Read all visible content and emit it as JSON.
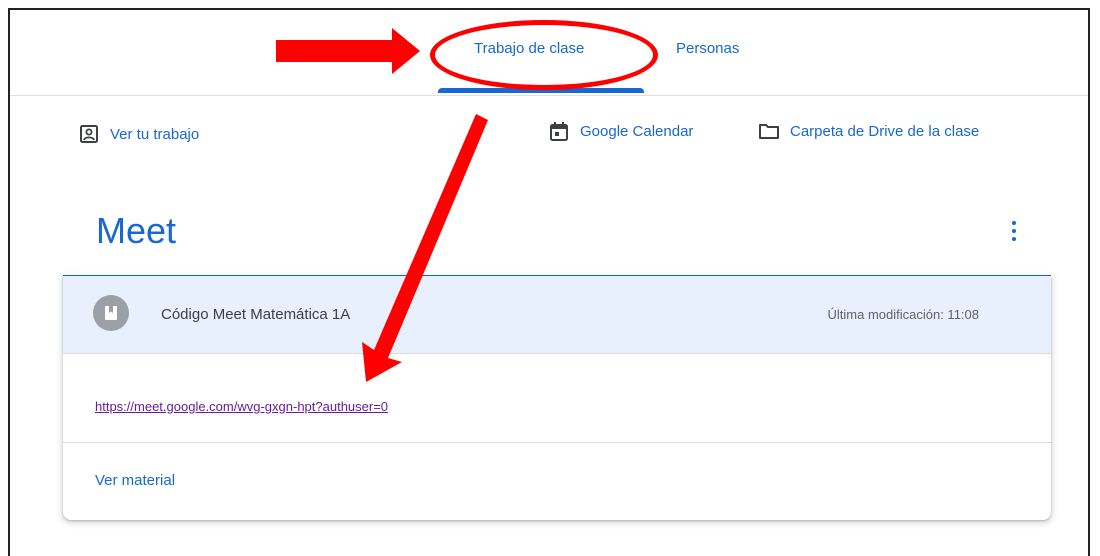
{
  "tabs": {
    "classwork": "Trabajo de clase",
    "people": "Personas"
  },
  "toolbar": {
    "my_work": "Ver tu trabajo",
    "calendar": "Google Calendar",
    "drive_folder": "Carpeta de Drive de la clase"
  },
  "topic": {
    "title": "Meet"
  },
  "material": {
    "title": "Código Meet Matemática 1A",
    "modified": "Última modificación: 11:08",
    "link": "https://meet.google.com/wvg-gxgn-hpt?authuser=0",
    "view_label": "Ver material"
  },
  "icons": {
    "my_work": "assignment-ind-icon",
    "calendar": "calendar-icon",
    "drive_folder": "folder-icon",
    "material": "book-icon",
    "menu": "more-vert-icon"
  },
  "colors": {
    "accent": "#1967d2",
    "annotation": "#ff0000",
    "header_bg": "#e8f0fe",
    "visited_link": "#6a1b9a"
  }
}
